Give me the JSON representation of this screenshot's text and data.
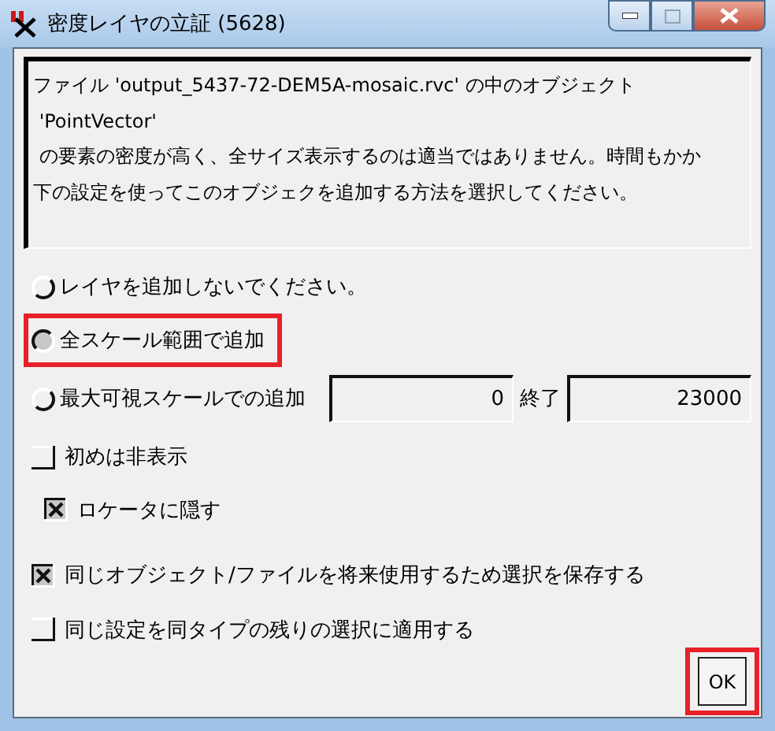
{
  "window": {
    "title": "密度レイヤの立証 (5628)"
  },
  "message": [
    "ファイル 'output_5437-72-DEM5A-mosaic.rvc' の中のオブジェクト",
    " 'PointVector'",
    " の要素の密度が高く、全サイズ表示するのは適当ではありません。時間もかか",
    "下の設定を使ってこのオブジェクを追加する方法を選択してください。"
  ],
  "options": [
    {
      "label": "レイヤを追加しないでください。",
      "selected": false,
      "highlighted": false
    },
    {
      "label": "全スケール範囲で追加",
      "selected": true,
      "highlighted": true
    },
    {
      "label": "最大可視スケールでの追加",
      "selected": false,
      "highlighted": false,
      "from": "0",
      "to_label": "終了",
      "to": "23000"
    }
  ],
  "checkboxes": [
    {
      "label": "初めは非表示",
      "checked": false,
      "children": [
        {
          "label": "ロケータに隠す",
          "checked": true
        }
      ]
    },
    {
      "label": "同じオブジェクト/ファイルを将来使用するため選択を保存する",
      "checked": true
    },
    {
      "label": "同じ設定を同タイプの残りの選択に適用する",
      "checked": false
    }
  ],
  "ok_button": {
    "label": "OK",
    "highlighted": true
  }
}
